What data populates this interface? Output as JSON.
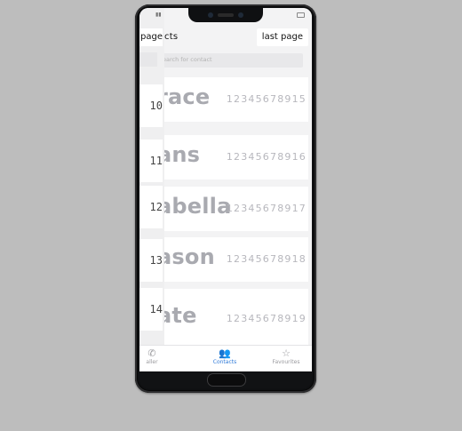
{
  "back_page": {
    "title": "page",
    "numbers": [
      "10",
      "11",
      "12",
      "13",
      "14"
    ],
    "nav_label": "es"
  },
  "front_page": {
    "title": "cts",
    "last_button": "last page",
    "search_placeholder": "earch for contact",
    "contacts": [
      {
        "name": "race",
        "phone": "12345678915"
      },
      {
        "name": "ans",
        "phone": "12345678916"
      },
      {
        "name": "abella",
        "phone": "12345678917"
      },
      {
        "name": "ason",
        "phone": "12345678918"
      },
      {
        "name": "ate",
        "phone": "12345678919"
      }
    ]
  },
  "bottom_nav": {
    "items": [
      {
        "label": "aller",
        "icon": "phone-icon"
      },
      {
        "label": "Contacts",
        "icon": "people-icon",
        "active": true
      },
      {
        "label": "Favourites",
        "icon": "star-icon"
      }
    ]
  },
  "colors": {
    "accent": "#2f7ad8",
    "page_bg": "#bdbdbd",
    "name_text": "#a9aab0"
  }
}
